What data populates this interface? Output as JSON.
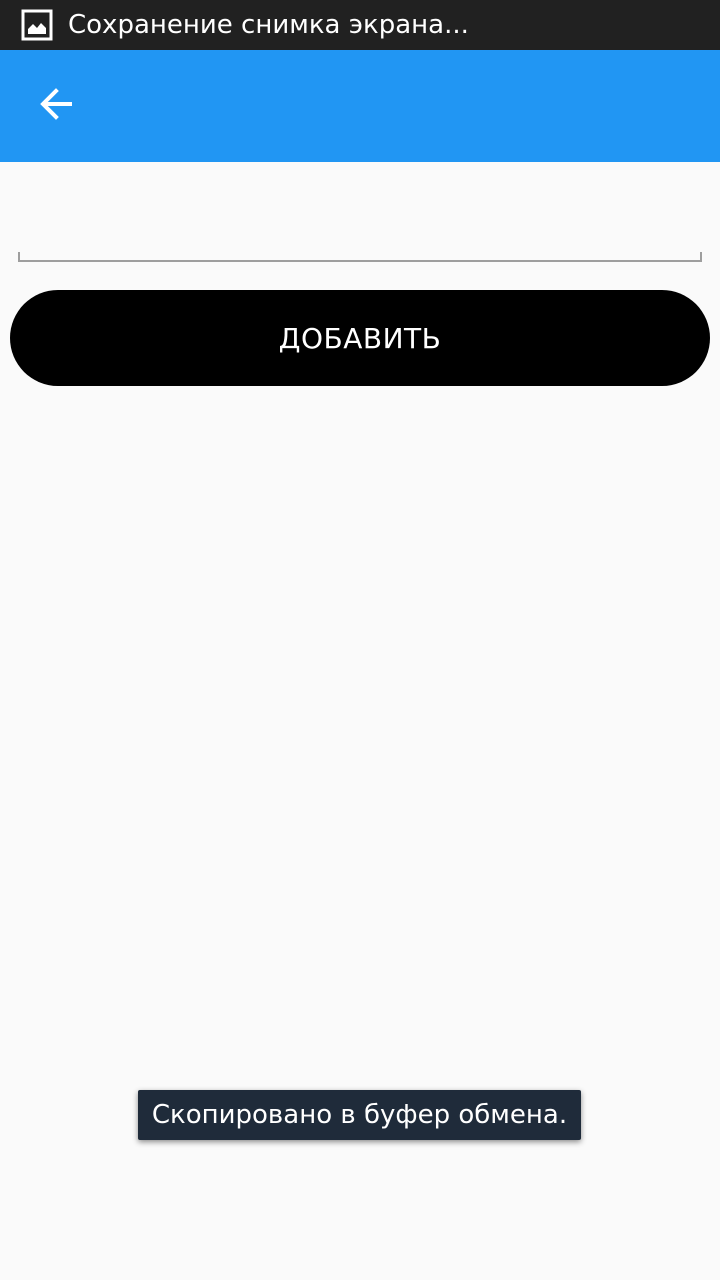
{
  "status_bar": {
    "notification_icon": "image-icon",
    "notification_text": "Сохранение снимка экрана..."
  },
  "app_bar": {
    "back_icon": "arrow-left-icon",
    "color": "#2196f3"
  },
  "form": {
    "input_value": "",
    "input_placeholder": "",
    "add_button_label": "ДОБАВИТЬ"
  },
  "toast": {
    "text": "Скопировано в буфер обмена."
  }
}
